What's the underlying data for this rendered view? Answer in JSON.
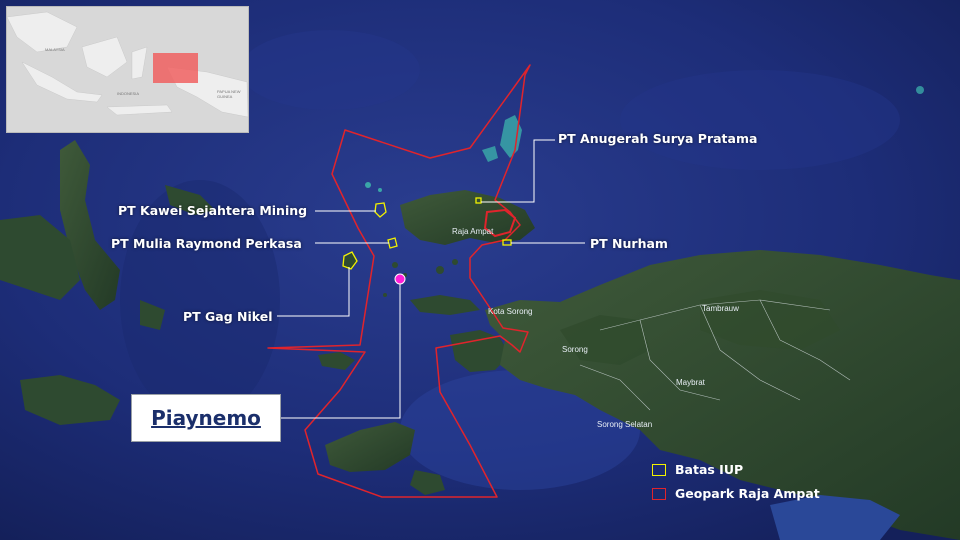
{
  "map": {
    "labels": {
      "anugerah": "PT Anugerah Surya Pratama",
      "kawei": "PT Kawei Sejahtera Mining",
      "mulia": "PT Mulia Raymond Perkasa",
      "nurham": "PT Nurham",
      "gag": "PT Gag Nikel"
    },
    "places": {
      "raja_ampat": "Raja Ampat",
      "kota_sorong": "Kota Sorong",
      "sorong": "Sorong",
      "tambrauw": "Tambrauw",
      "maybrat": "Maybrat",
      "sorong_selatan": "Sorong Selatan"
    },
    "highlight": "Piaynemo",
    "inset": {
      "labels": [
        "MALAYSIA",
        "INDONESIA",
        "PAPUA NEW GUINEA"
      ]
    }
  },
  "legend": {
    "items": [
      {
        "label": "Batas IUP",
        "color": "#f2f200"
      },
      {
        "label": "Geopark Raja Ampat",
        "color": "#e0242c"
      }
    ]
  },
  "colors": {
    "boundary": "#e0242c",
    "iup": "#f2f200",
    "marker": "#ff1fd8",
    "inset_region": "#f06060"
  }
}
